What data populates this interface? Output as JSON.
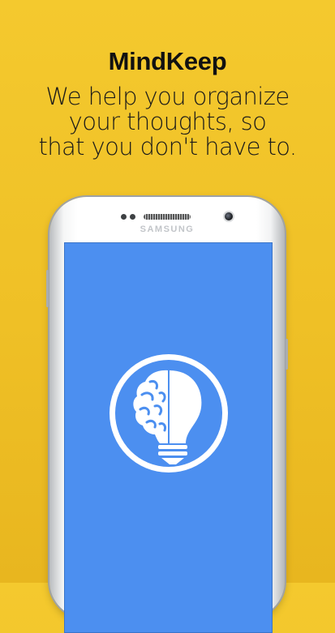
{
  "app": {
    "name": "MindKeep",
    "tagline_lines": [
      "We help you organize",
      "your thoughts, so",
      "that you don't have to."
    ]
  },
  "device": {
    "brand": "SAMSUNG"
  },
  "colors": {
    "background": "#f4c92e",
    "screen": "#4c8ff0",
    "logo_ring": "#ffffff"
  },
  "icons": {
    "logo": "brain-lightbulb-icon"
  }
}
